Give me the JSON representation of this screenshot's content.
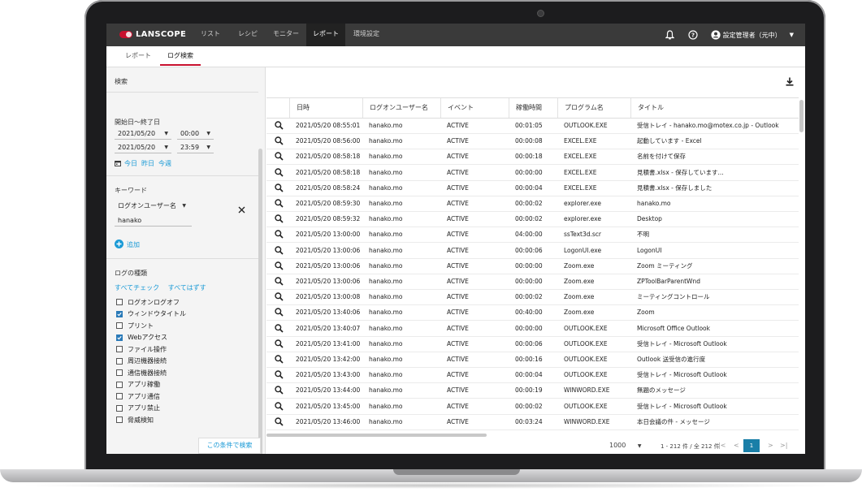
{
  "app": {
    "logo": "LANSCOPE",
    "nav": [
      {
        "label": "リスト"
      },
      {
        "label": "レシピ"
      },
      {
        "label": "モニター"
      },
      {
        "label": "レポート"
      },
      {
        "label": "環境設定"
      }
    ],
    "active_nav": "レポート",
    "user": "設定管理者（元中）",
    "icons": [
      "bell-icon",
      "help-icon",
      "user-icon"
    ]
  },
  "subtabs": [
    {
      "label": "レポート"
    },
    {
      "label": "ログ検索"
    }
  ],
  "active_subtab": "ログ検索",
  "search_panel": {
    "title": "検索",
    "date_title": "開始日～終了日",
    "start_date": "2021/05/20",
    "start_time": "00:00",
    "end_date": "2021/05/20",
    "end_time": "23:59",
    "quick_links": [
      "今日",
      "昨日",
      "今週"
    ],
    "keyword_title": "キーワード",
    "keyword_field": "ログオンユーザー名",
    "keyword_value": "hanako",
    "add_label": "追加",
    "logtype_title": "ログの種類",
    "check_all": "すべてチェック",
    "uncheck_all": "すべてはずす",
    "log_types": [
      {
        "label": "ログオンログオフ",
        "checked": false
      },
      {
        "label": "ウィンドウタイトル",
        "checked": true
      },
      {
        "label": "プリント",
        "checked": false
      },
      {
        "label": "Webアクセス",
        "checked": true
      },
      {
        "label": "ファイル操作",
        "checked": false
      },
      {
        "label": "周辺機器接続",
        "checked": false
      },
      {
        "label": "通信機器接続",
        "checked": false
      },
      {
        "label": "アプリ稼働",
        "checked": false
      },
      {
        "label": "アプリ通信",
        "checked": false
      },
      {
        "label": "アプリ禁止",
        "checked": false
      },
      {
        "label": "脅威検知",
        "checked": false
      }
    ],
    "search_button": "この条件で検索"
  },
  "table": {
    "headers": [
      "日時",
      "ログオンユーザー名",
      "イベント",
      "稼働時間",
      "プログラム名",
      "タイトル"
    ],
    "rows": [
      [
        "2021/05/20 08:55:01",
        "hanako.mo",
        "ACTIVE",
        "00:01:05",
        "OUTLOOK.EXE",
        "受信トレイ - hanako.mo@motex.co.jp - Outlook"
      ],
      [
        "2021/05/20 08:56:00",
        "hanako.mo",
        "ACTIVE",
        "00:00:08",
        "EXCEL.EXE",
        "起動しています - Excel"
      ],
      [
        "2021/05/20 08:58:18",
        "hanako.mo",
        "ACTIVE",
        "00:00:18",
        "EXCEL.EXE",
        "名前を付けて保存"
      ],
      [
        "2021/05/20 08:58:18",
        "hanako.mo",
        "ACTIVE",
        "00:00:00",
        "EXCEL.EXE",
        "見積書.xlsx - 保存しています..."
      ],
      [
        "2021/05/20 08:58:24",
        "hanako.mo",
        "ACTIVE",
        "00:00:04",
        "EXCEL.EXE",
        "見積書.xlsx - 保存しました"
      ],
      [
        "2021/05/20 08:59:30",
        "hanako.mo",
        "ACTIVE",
        "00:00:02",
        "explorer.exe",
        "hanako.mo"
      ],
      [
        "2021/05/20 08:59:32",
        "hanako.mo",
        "ACTIVE",
        "00:00:02",
        "explorer.exe",
        "Desktop"
      ],
      [
        "2021/05/20 13:00:00",
        "hanako.mo",
        "ACTIVE",
        "04:00:00",
        "ssText3d.scr",
        "不明"
      ],
      [
        "2021/05/20 13:00:06",
        "hanako.mo",
        "ACTIVE",
        "00:00:06",
        "LogonUI.exe",
        "LogonUI"
      ],
      [
        "2021/05/20 13:00:06",
        "hanako.mo",
        "ACTIVE",
        "00:00:00",
        "Zoom.exe",
        "Zoom ミーティング"
      ],
      [
        "2021/05/20 13:00:06",
        "hanako.mo",
        "ACTIVE",
        "00:00:00",
        "Zoom.exe",
        "ZPToolBarParentWnd"
      ],
      [
        "2021/05/20 13:00:08",
        "hanako.mo",
        "ACTIVE",
        "00:00:02",
        "Zoom.exe",
        "ミーティングコントロール"
      ],
      [
        "2021/05/20 13:40:06",
        "hanako.mo",
        "ACTIVE",
        "00:40:00",
        "Zoom.exe",
        "Zoom"
      ],
      [
        "2021/05/20 13:40:07",
        "hanako.mo",
        "ACTIVE",
        "00:00:00",
        "OUTLOOK.EXE",
        "Microsoft Office Outlook"
      ],
      [
        "2021/05/20 13:41:00",
        "hanako.mo",
        "ACTIVE",
        "00:00:06",
        "OUTLOOK.EXE",
        "受信トレイ - Microsoft Outlook"
      ],
      [
        "2021/05/20 13:42:00",
        "hanako.mo",
        "ACTIVE",
        "00:00:16",
        "OUTLOOK.EXE",
        "Outlook 送受信の進行度"
      ],
      [
        "2021/05/20 13:43:00",
        "hanako.mo",
        "ACTIVE",
        "00:00:04",
        "OUTLOOK.EXE",
        "受信トレイ - Microsoft Outlook"
      ],
      [
        "2021/05/20 13:44:00",
        "hanako.mo",
        "ACTIVE",
        "00:00:19",
        "WINWORD.EXE",
        "無題のメッセージ"
      ],
      [
        "2021/05/20 13:45:00",
        "hanako.mo",
        "ACTIVE",
        "00:00:02",
        "OUTLOOK.EXE",
        "受信トレイ - Microsoft Outlook"
      ],
      [
        "2021/05/20 13:46:00",
        "hanako.mo",
        "ACTIVE",
        "00:03:24",
        "WINWORD.EXE",
        "本日会議の件 - メッセージ"
      ]
    ]
  },
  "pager": {
    "page_size": "1000",
    "range_text": "1 - 212 件 / 全 212 件",
    "current_page": "1"
  }
}
